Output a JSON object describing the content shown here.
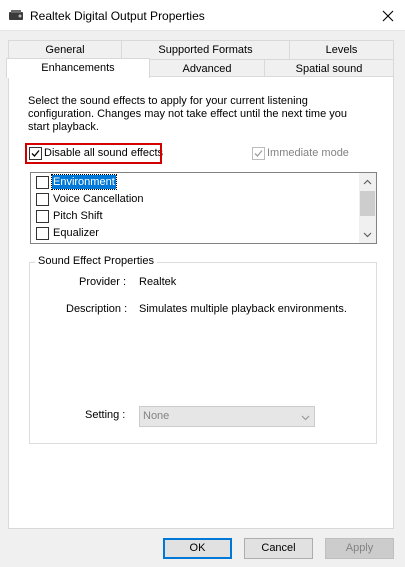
{
  "window": {
    "title": "Realtek Digital Output Properties"
  },
  "tabs_row_back": [
    {
      "label": "General"
    },
    {
      "label": "Supported Formats"
    },
    {
      "label": "Levels"
    }
  ],
  "tabs_row_front": [
    {
      "label": "Enhancements",
      "selected": true
    },
    {
      "label": "Advanced"
    },
    {
      "label": "Spatial sound"
    }
  ],
  "enhancements": {
    "description": "Select the sound effects to apply for your current listening configuration. Changes may not take effect until the next time you start playback.",
    "disable_all_label": "Disable all sound effects",
    "disable_all_checked": true,
    "immediate_mode_label": "Immediate mode",
    "immediate_mode_checked": true,
    "effects": [
      {
        "label": "Environment",
        "checked": false,
        "selected": true
      },
      {
        "label": "Voice Cancellation",
        "checked": false
      },
      {
        "label": "Pitch Shift",
        "checked": false
      },
      {
        "label": "Equalizer",
        "checked": false
      }
    ],
    "properties": {
      "title": "Sound Effect Properties",
      "provider_label": "Provider :",
      "provider_value": "Realtek",
      "description_label": "Description :",
      "description_value": "Simulates multiple playback environments.",
      "setting_label": "Setting :",
      "setting_value": "None"
    }
  },
  "buttons": {
    "ok": "OK",
    "cancel": "Cancel",
    "apply": "Apply"
  },
  "colors": {
    "accent": "#0078d7",
    "highlight_box": "#d20000"
  }
}
